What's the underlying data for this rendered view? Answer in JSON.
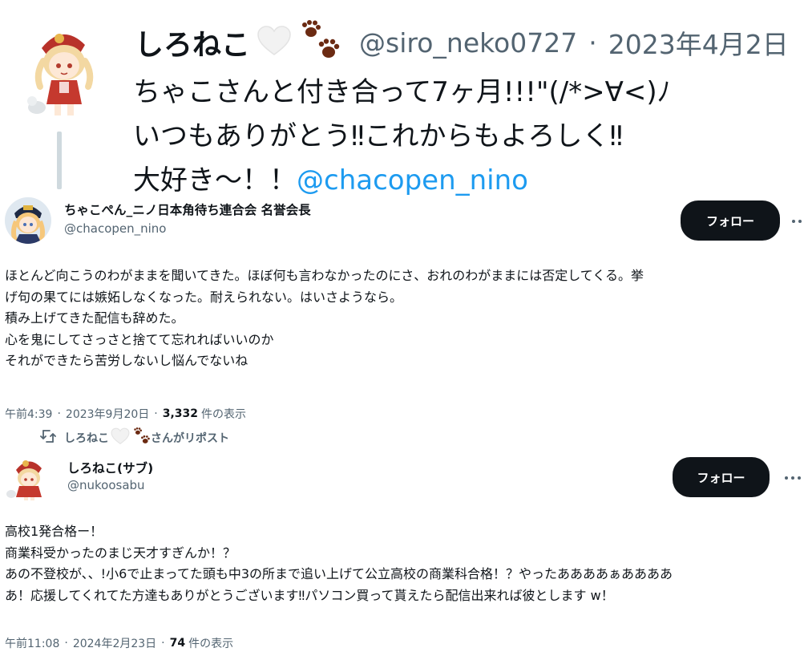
{
  "quoted_tweet": {
    "author_name": "しろねこ",
    "handle": "@siro_neko0727",
    "separator": "·",
    "date": "2023年4月2日",
    "lines": [
      "ちゃこさんと付き合って7ヶ月!!!\"(/*>∀<)ﾉ",
      "いつもありがとう‼これからもよろしく‼"
    ],
    "line3_text": "大好き〜！！",
    "mention": "@chacopen_nino"
  },
  "tweet1": {
    "display_name": "ちゃこぺん_ニノ日本角待ち連合会 名誉会長",
    "handle": "@chacopen_nino",
    "follow_label": "フォロー",
    "body_lines": [
      "ほとんど向こうのわがままを聞いてきた。ほぼ何も言わなかったのにさ、おれのわがままには否定してくる。挙",
      "げ句の果てには嫉妬しなくなった。耐えられない。はいさようなら。",
      "積み上げてきた配信も辞めた。",
      "心を鬼にしてさっさと捨てて忘れればいいのか",
      "それができたら苦労しないし悩んでないね"
    ],
    "time": "午前4:39",
    "separator": "·",
    "date": "2023年9月20日",
    "views_count": "3,332",
    "views_label": "件の表示"
  },
  "repost_bar": {
    "name": "しろねこ",
    "suffix": "さんがリポスト"
  },
  "tweet2": {
    "display_name": "しろねこ(サブ)",
    "handle": "@nukoosabu",
    "follow_label": "フォロー",
    "body_lines": [
      "高校1発合格ー！",
      "商業科受かったのまじ天才すぎんか！？",
      "あの不登校が、、!小6で止まってた頭も中3の所まで追い上げて公立高校の商業科合格！？やったああああぁああああ",
      "あ！応援してくれてた方達もありがとうございます‼パソコン買って貰えたら配信出来れば彼とします w！"
    ],
    "time": "午前11:08",
    "separator": "·",
    "date": "2024年2月23日",
    "views_count": "74",
    "views_label": "件の表示"
  },
  "icons": {
    "heart": "white-heart-icon",
    "paws": "paw-prints-icon",
    "repost": "repost-icon",
    "more": "more-icon"
  },
  "colors": {
    "link": "#1d9bf0",
    "secondary_text": "#536471",
    "follow_button": "#0f1419",
    "paw": "#6b2a12"
  }
}
